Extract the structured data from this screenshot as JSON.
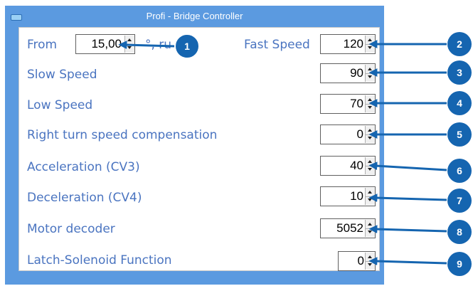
{
  "window": {
    "title": "Profi - Bridge Controller"
  },
  "from": {
    "label": "From",
    "value": "15,00",
    "suffix": "°, ru"
  },
  "fields": [
    {
      "label": "Fast Speed",
      "value": "120"
    },
    {
      "label": "Slow Speed",
      "value": "90"
    },
    {
      "label": "Low Speed",
      "value": "70"
    },
    {
      "label": "Right turn speed compensation",
      "value": "0"
    },
    {
      "label": "Acceleration (CV3)",
      "value": "40"
    },
    {
      "label": "Deceleration (CV4)",
      "value": "10"
    },
    {
      "label": "Motor decoder",
      "value": "5052"
    },
    {
      "label": "Latch-Solenoid Function",
      "value": "0"
    }
  ],
  "callouts": [
    "1",
    "2",
    "3",
    "4",
    "5",
    "6",
    "7",
    "8",
    "9"
  ],
  "colors": {
    "titlebar": "#5b9ae0",
    "label": "#4a74c0",
    "callout": "#1565b0"
  }
}
